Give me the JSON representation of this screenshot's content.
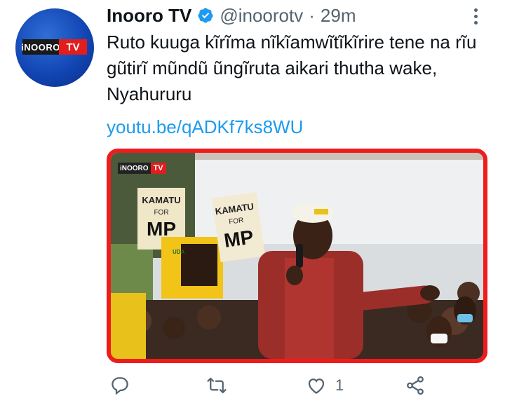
{
  "tweet": {
    "display_name": "Inooro TV",
    "handle": "@inoorotv",
    "separator": "·",
    "time": "29m",
    "text": "Ruto kuuga kĩrĩma nĩkĩamwĩtĩkĩrire tene na rĩu gũtirĩ mũndũ ũngĩruta aikari thutha wake, Nyahururu",
    "link": "youtu.be/qADKf7ks8WU",
    "verified_icon": "verified-badge-icon",
    "more_icon": "more-options-icon"
  },
  "avatar": {
    "logo_left": "iNOORO",
    "logo_right": "TV"
  },
  "media": {
    "badge_left": "iNOORO",
    "badge_right": "TV",
    "sign1_line1": "KAMATU",
    "sign1_line2": "FOR",
    "sign1_line3": "MP",
    "sign2_line1": "KAMATU",
    "sign2_line2": "FOR",
    "sign2_line3": "MP",
    "poster_party": "UDA",
    "border_color": "#ee1c1c"
  },
  "actions": {
    "reply_icon": "reply-icon",
    "retweet_icon": "retweet-icon",
    "like_icon": "like-heart-icon",
    "like_count": "1",
    "share_icon": "share-icon"
  },
  "colors": {
    "link": "#1d9bf0",
    "secondary_text": "#536471",
    "verified": "#1d9bf0"
  }
}
